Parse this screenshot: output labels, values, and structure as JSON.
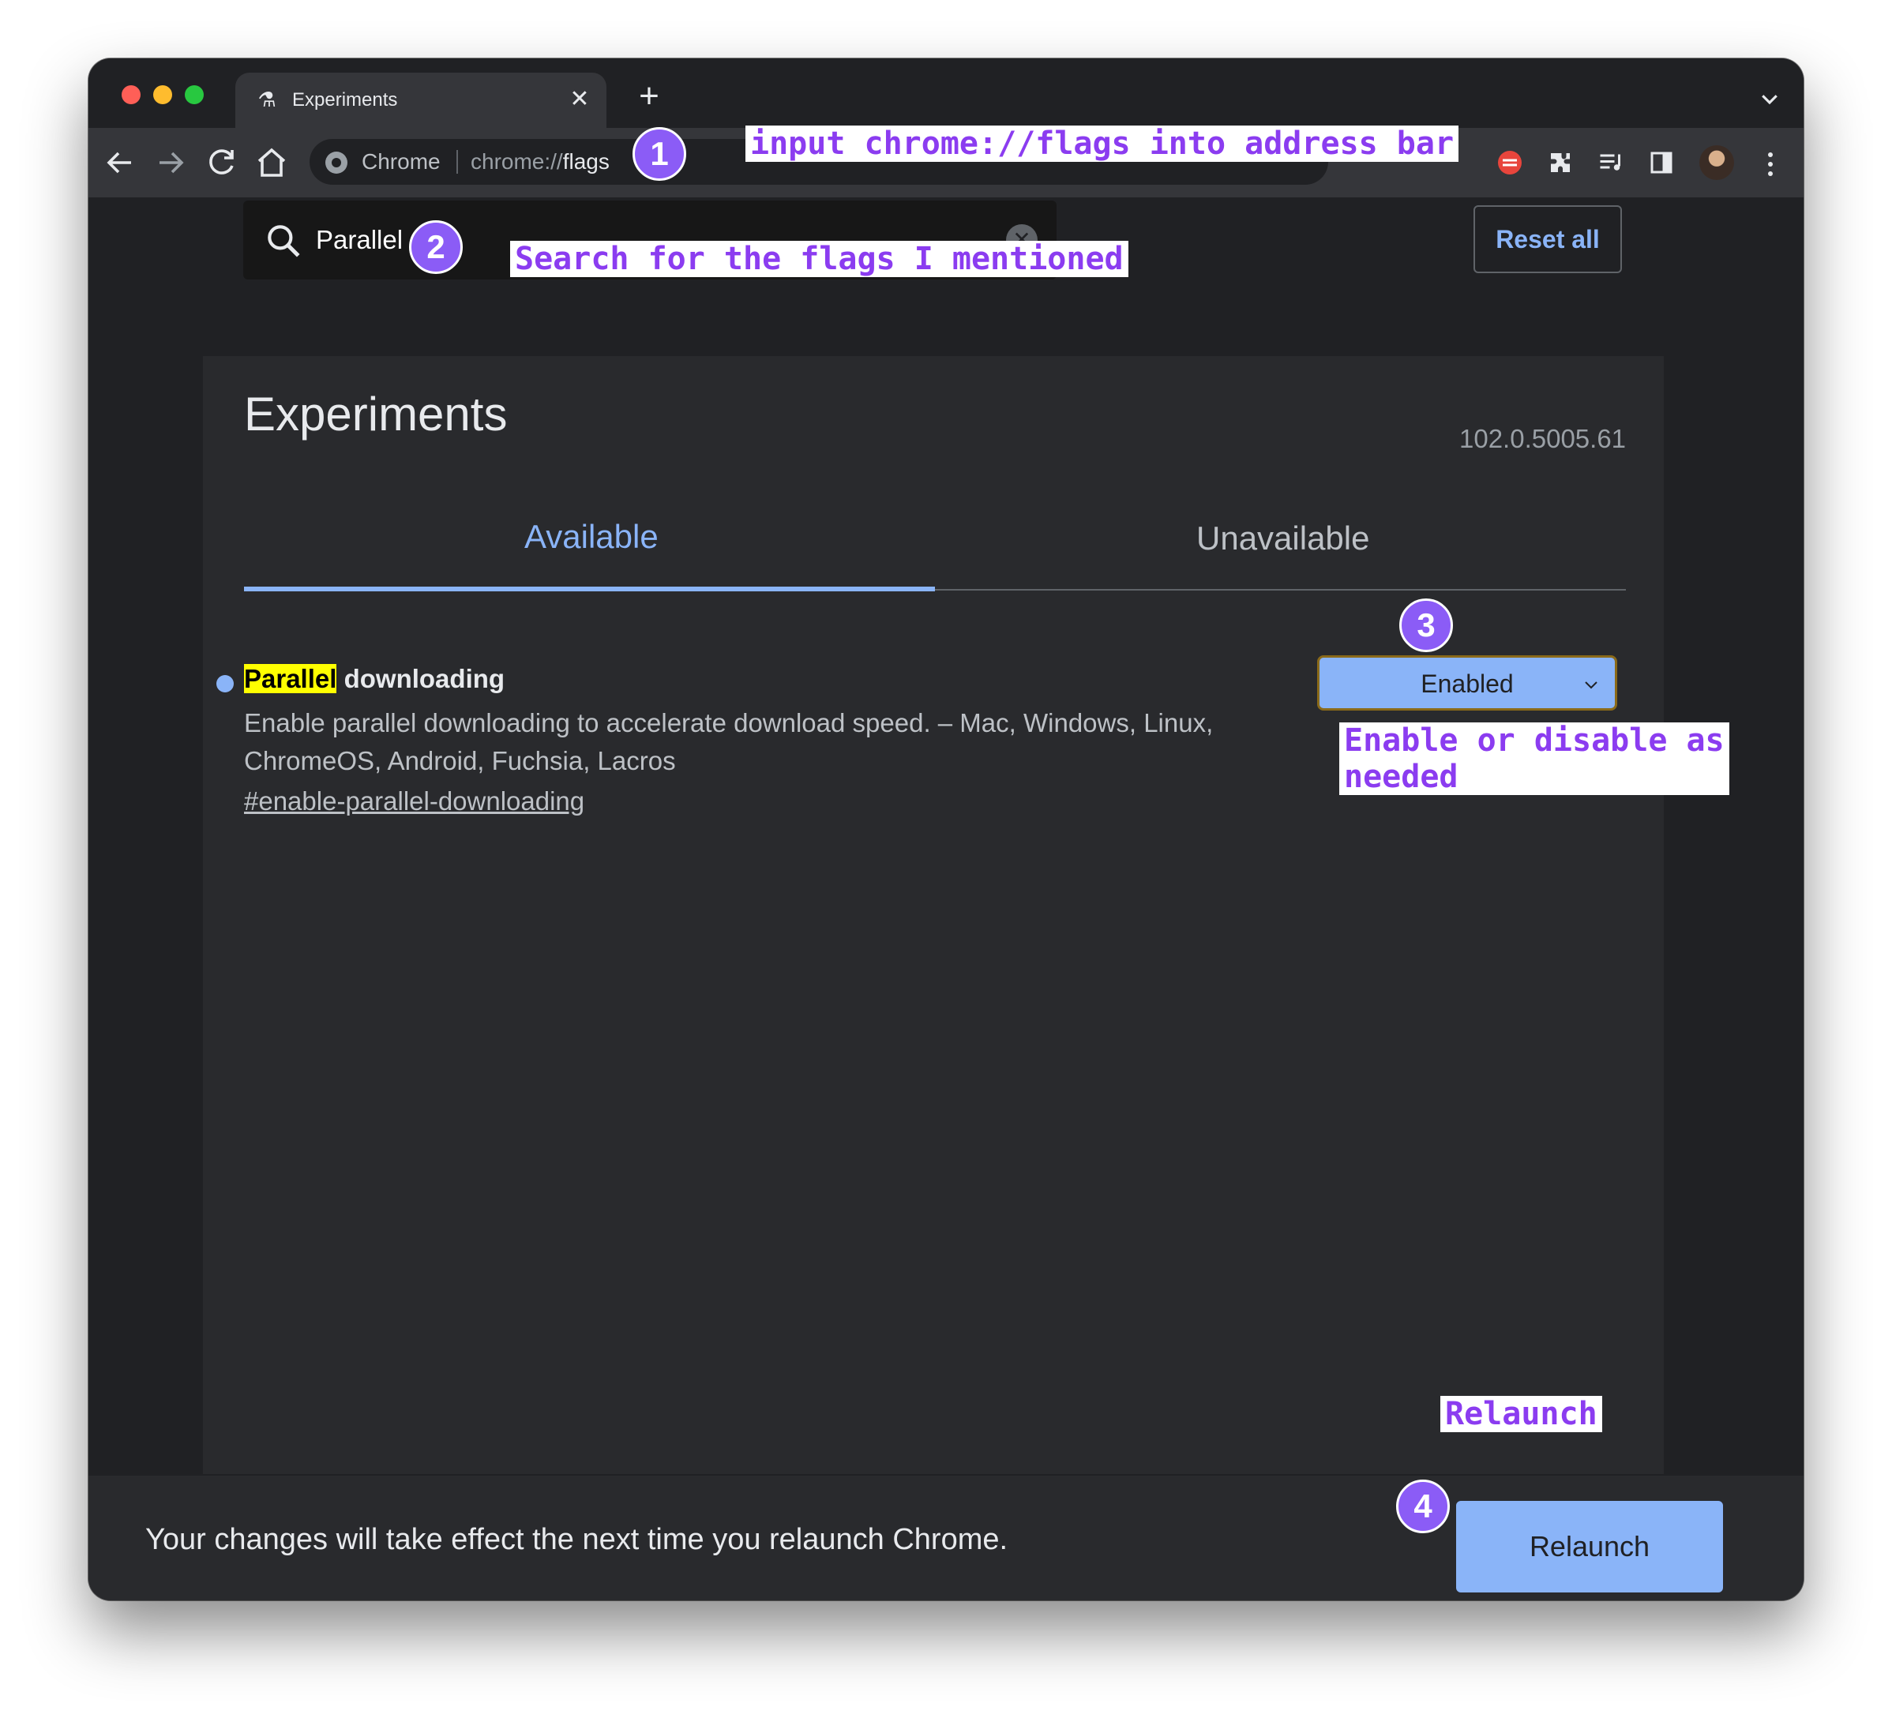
{
  "browser": {
    "tab": {
      "title": "Experiments",
      "close_glyph": "✕"
    },
    "new_tab_glyph": "+",
    "omnibox": {
      "chip": "Chrome",
      "url_prefix": "chrome://",
      "url_path": "flags"
    },
    "icons": [
      "back-icon",
      "forward-icon",
      "reload-icon",
      "home-icon",
      "extension-icon",
      "puzzle-icon",
      "media-icon",
      "side-panel-icon",
      "profile-avatar",
      "menu-icon"
    ]
  },
  "search": {
    "value": "Parallel",
    "clear_glyph": "✕"
  },
  "header": {
    "reset_label": "Reset all"
  },
  "page": {
    "title": "Experiments",
    "version": "102.0.5005.61",
    "tabs": [
      {
        "label": "Available",
        "active": true
      },
      {
        "label": "Unavailable",
        "active": false
      }
    ]
  },
  "flag": {
    "title_highlight": "Parallel",
    "title_rest": " downloading",
    "description": "Enable parallel downloading to accelerate download speed. – Mac, Windows, Linux, ChromeOS, Android, Fuchsia, Lacros",
    "link": "#enable-parallel-downloading",
    "selected_option": "Enabled"
  },
  "bottom": {
    "message": "Your changes will take effect the next time you relaunch Chrome.",
    "relaunch_label": "Relaunch"
  },
  "annotations": {
    "step1": "1",
    "step2": "2",
    "step3": "3",
    "step4": "4",
    "note1": "input chrome://flags into address bar",
    "note2": "Search for the flags I mentioned",
    "note3": "Enable or disable as\nneeded",
    "note4": "Relaunch"
  },
  "colors": {
    "accent": "#8ab4f8",
    "annotation_purple": "#8b5cf6",
    "highlight": "#ffff00",
    "page_bg": "#202124",
    "card_bg": "#292a2d"
  }
}
